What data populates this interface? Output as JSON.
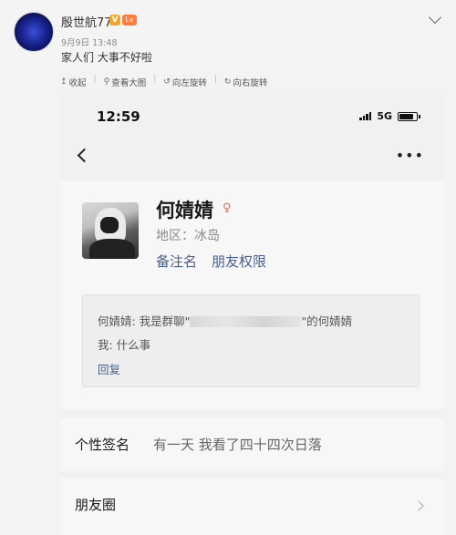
{
  "post": {
    "username": "殷世航77",
    "vip_badge": "V",
    "level_badge": "Lv",
    "time": "9月9日 13:48",
    "text": "家人们 大事不好啦"
  },
  "toolbar": {
    "items": [
      {
        "icon": "collapse-icon",
        "glyph": "↥",
        "label": "收起"
      },
      {
        "icon": "search-icon",
        "glyph": "⚲",
        "label": "查看大图"
      },
      {
        "icon": "rotate-left-icon",
        "glyph": "↺",
        "label": "向左旋转"
      },
      {
        "icon": "rotate-right-icon",
        "glyph": "↻",
        "label": "向右旋转"
      }
    ]
  },
  "screenshot": {
    "status_time": "12:59",
    "network": "5G",
    "contact": {
      "name": "何婧婧",
      "region": "地区：冰岛",
      "actions": [
        "备注名",
        "朋友权限"
      ]
    },
    "request": {
      "line1_prefix": "何婧婧: 我是群聊\"",
      "line1_suffix": "\"的何婧婧",
      "line2": "我: 什么事",
      "reply": "回复"
    },
    "signature_label": "个性签名",
    "signature_value": "有一天 我看了四十四次日落",
    "moments_label": "朋友圈"
  }
}
